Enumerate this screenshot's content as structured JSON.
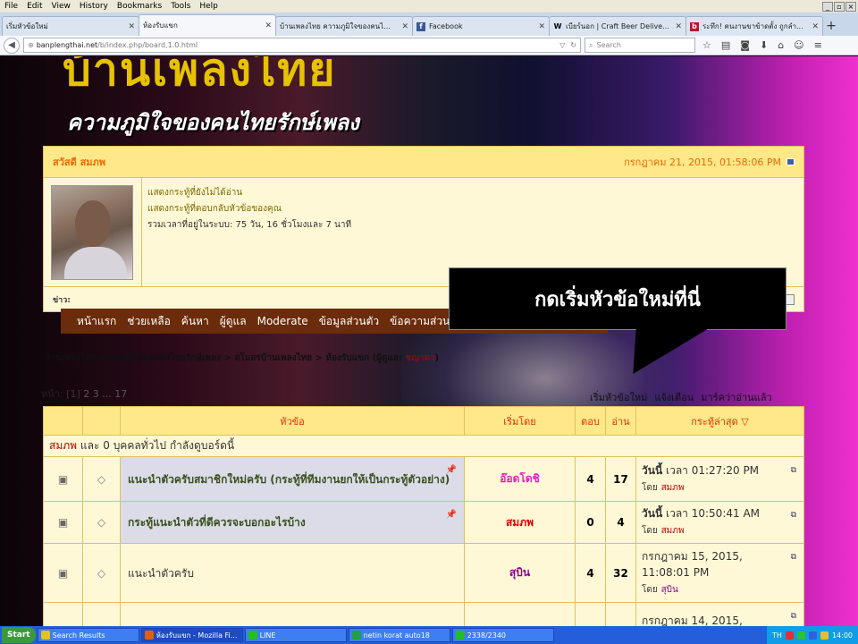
{
  "menubar": {
    "items": [
      "File",
      "Edit",
      "View",
      "History",
      "Bookmarks",
      "Tools",
      "Help"
    ]
  },
  "tabs": [
    {
      "label": "เริ่มหัวข้อใหม่",
      "icon": "",
      "active": false
    },
    {
      "label": "ห้องรับแขก",
      "icon": "",
      "active": true
    },
    {
      "label": "บ้านเพลงไทย ความภูมิใจของคนไ...",
      "icon": "",
      "active": false
    },
    {
      "label": "Facebook",
      "icon": "f",
      "active": false
    },
    {
      "label": "เบียร์นอก | Craft Beer Delive...",
      "icon": "W",
      "active": false
    },
    {
      "label": "ระทึก! คนงานขาข้าดตั้ง ถูกลำ...",
      "icon": "b",
      "active": false
    }
  ],
  "navbar": {
    "url_domain": "banplengthai.net",
    "url_path": "/b/index.php/board,1.0.html",
    "search_placeholder": "Search"
  },
  "banner": {
    "title": "บ้านเพลงไทย",
    "subtitle": "ความภูมิใจของคนไทยรักษ์เพลง"
  },
  "user_panel": {
    "greeting": "สวัสดี สมภพ",
    "datetime": "กรกฎาคม 21, 2015, 01:58:06 PM",
    "links": [
      "แสดงกระทู้ที่ยังไม่ได้อ่าน",
      "แสดงกระทู้ที่ตอบกลับหัวข้อของคุณ"
    ],
    "online_time": "รวมเวลาที่อยู่ในระบบ: 75 วัน, 16 ชั่วโมงและ 7 นาที",
    "news_label": "ข่าว:"
  },
  "main_nav": [
    "หน้าแรก",
    "ช่วยเหลือ",
    "ค้นหา",
    "ผู้ดูแล",
    "Moderate",
    "ข้อมูลส่วนตัว",
    "ข้อความส่วนตัว"
  ],
  "callout": "กดเริ่มหัวข้อใหม่ที่นี่",
  "breadcrumb": {
    "path": "บ้านเพลงไทย ความภูมิใจของคนไทยรักษ์เพลง > สโมสรบ้านเพลงไทย > ห้องรับแขก",
    "moderators_label": "(ผู้ดูแล:",
    "moderator": "ชญาดา",
    "close": ")"
  },
  "pagination": {
    "label": "หน้า:",
    "current": "[1]",
    "rest": "2 3 ... 17"
  },
  "board_actions": [
    "เริ่มหัวข้อใหม่",
    "แจ้งเตือน",
    "มาร์คว่าอ่านแล้ว"
  ],
  "table": {
    "headers": {
      "subject": "หัวข้อ",
      "starter": "เริ่มโดย",
      "replies": "ตอบ",
      "views": "อ่าน",
      "last_post": "กระทู้ล่าสุด ▽"
    },
    "viewing": {
      "user": "สมภพ",
      "text": "และ 0 บุคคลทั่วไป กำลังดูบอร์ดนี้"
    },
    "rows": [
      {
        "subject": "แนะนำตัวครับสมาชิกใหม่ครับ (กระทู้ที่ทีมงานยกให้เป็นกระทู้ตัวอย่าง)",
        "sticky": true,
        "starter": "อ๊อดโดชิ",
        "starter_color": "#e020c0",
        "replies": "4",
        "views": "17",
        "last_date": "วันนี้",
        "last_time": "เวลา 01:27:20 PM",
        "by_label": "โดย",
        "last_user": "สมภพ"
      },
      {
        "subject": "กระทู้แนะนำตัวที่ดีควรจะบอกอะไรบ้าง",
        "sticky": true,
        "starter": "สมภพ",
        "starter_color": "#dd0000",
        "replies": "0",
        "views": "4",
        "last_date": "วันนี้",
        "last_time": "เวลา 10:50:41 AM",
        "by_label": "โดย",
        "last_user": "สมภพ"
      },
      {
        "subject": "แนะนำตัวครับ",
        "sticky": false,
        "starter": "สุบิน",
        "starter_color": "#8a008a",
        "replies": "4",
        "views": "32",
        "last_date": "กรกฎาคม 15, 2015,",
        "last_time": "11:08:01 PM",
        "by_label": "โดย",
        "last_user": "สุบิน"
      },
      {
        "subject": "",
        "sticky": false,
        "starter": "",
        "starter_color": "#333333",
        "replies": "",
        "views": "",
        "last_date": "กรกฎาคม 14, 2015,",
        "last_time": "",
        "by_label": "",
        "last_user": ""
      }
    ]
  },
  "taskbar": {
    "start": "Start",
    "items": [
      {
        "label": "Search Results",
        "color": "#e8c020"
      },
      {
        "label": "ห้องรับแขก - Mozilla Fi...",
        "color": "#e06010"
      },
      {
        "label": "LINE",
        "color": "#20c020"
      },
      {
        "label": "netin korat auto18",
        "color": "#20a040"
      },
      {
        "label": "2338/2340",
        "color": "#20c020"
      }
    ],
    "lang": "TH",
    "clock": "14:00"
  }
}
